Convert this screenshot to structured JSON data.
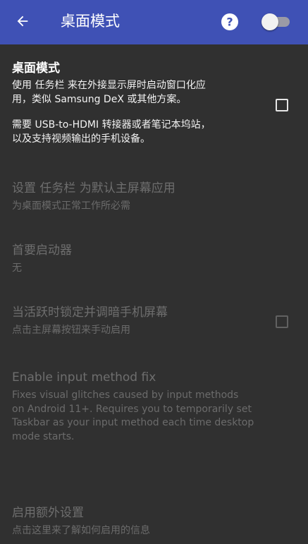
{
  "app_bar": {
    "title": "桌面模式",
    "back_icon": "arrow-back-icon",
    "help_icon": "help-icon",
    "switch_state": "off"
  },
  "settings": {
    "desktop_mode": {
      "title": "桌面模式",
      "summary_line1": "使用 任务栏 来在外接显示屏时启动窗口化应",
      "summary_line2": "用，类似 Samsung DeX 或其他方案。",
      "summary_line3": "需要 USB-to-HDMI 转接器或者笔记本坞站，",
      "summary_line4": "以及支持视频输出的手机设备。",
      "checked": false
    },
    "set_default_home": {
      "title": "设置 任务栏 为默认主屏幕应用",
      "summary": "为桌面模式正常工作所必需"
    },
    "primary_launcher": {
      "title": "首要启动器",
      "summary": "无"
    },
    "lock_dim_screen": {
      "title": "当活跃时锁定并调暗手机屏幕",
      "summary": "点击主屏幕按钮来手动启用",
      "checked": false
    },
    "input_method_fix": {
      "title": "Enable input method fix",
      "summary_line1": "Fixes visual glitches caused by input methods",
      "summary_line2": "on Android 11+. Requires you to temporarily set",
      "summary_line3": "Taskbar as your input method each time desktop",
      "summary_line4": "mode starts."
    },
    "extra_settings": {
      "title": "启用额外设置",
      "summary": "点击这里来了解如何启用的信息"
    }
  }
}
